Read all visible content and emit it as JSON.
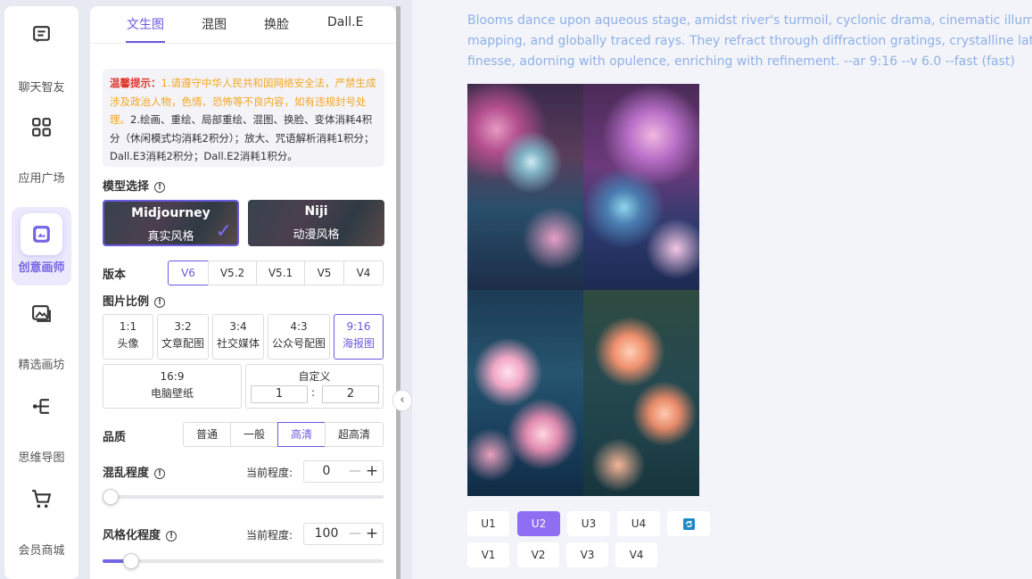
{
  "sidebar": {
    "items": [
      {
        "label": "聊天智友",
        "icon": "chat-icon"
      },
      {
        "label": "应用广场",
        "icon": "apps-grid-icon"
      },
      {
        "label": "创意画师",
        "icon": "paint-icon",
        "active": true
      },
      {
        "label": "精选画坊",
        "icon": "gallery-icon"
      },
      {
        "label": "思维导图",
        "icon": "mindmap-icon"
      },
      {
        "label": "会员商城",
        "icon": "cart-icon"
      }
    ]
  },
  "panel": {
    "tabs": [
      "文生图",
      "混图",
      "换脸",
      "Dall.E"
    ],
    "active_tab": "文生图",
    "notice": {
      "title": "温馨提示：",
      "part1": "1.请遵守中华人民共和国网络安全法，严禁生成涉及政治人物，色情、恐怖等不良内容，如有违规封号处理。",
      "part2": "2.绘画、重绘、局部重绘、混图、换脸、变体消耗4积分（休闲模式均消耗2积分）；放大、咒语解析消耗1积分；Dall.E3消耗2积分；Dall.E2消耗1积分。"
    },
    "model_title": "模型选择",
    "models": [
      {
        "name": "Midjourney",
        "desc": "真实风格",
        "selected": true
      },
      {
        "name": "Niji",
        "desc": "动漫风格",
        "selected": false
      }
    ],
    "version_title": "版本",
    "versions": [
      "V6",
      "V5.2",
      "V5.1",
      "V5",
      "V4"
    ],
    "active_version": "V6",
    "ratio_title": "图片比例",
    "ratios": [
      {
        "ratio": "1:1",
        "label": "头像"
      },
      {
        "ratio": "3:2",
        "label": "文章配图"
      },
      {
        "ratio": "3:4",
        "label": "社交媒体"
      },
      {
        "ratio": "4:3",
        "label": "公众号配图"
      },
      {
        "ratio": "9:16",
        "label": "海报图"
      },
      {
        "ratio": "16:9",
        "label": "电脑壁纸"
      }
    ],
    "active_ratio": "9:16",
    "custom": {
      "label": "自定义",
      "w": "1",
      "sep": ":",
      "h": "2"
    },
    "quality_title": "品质",
    "qualities": [
      "普通",
      "一般",
      "高清",
      "超高清"
    ],
    "active_quality": "高清",
    "chaos": {
      "title": "混乱程度",
      "current_label": "当前程度:",
      "value": "0",
      "fraction": 0
    },
    "stylize": {
      "title": "风格化程度",
      "current_label": "当前程度:",
      "value": "100",
      "fraction": 0.1
    },
    "collapse_icon": "chevron-left-icon"
  },
  "main": {
    "prompt_lines": [
      "Blooms dance upon aqueous stage, amidst river's turmoil, cyclonic drama, cinematic illuminatio",
      "mapping, and globally traced rays. They refract through diffraction gratings, crystalline lattices",
      "finesse, adorning with opulence, enriching with refinement. --ar 9:16 --v 6.0 --fast  (fast)"
    ],
    "upscale_buttons": [
      "U1",
      "U2",
      "U3",
      "U4"
    ],
    "active_upscale": "U2",
    "refresh_icon": "refresh-icon",
    "variation_buttons": [
      "V1",
      "V2",
      "V3",
      "V4"
    ],
    "colors": {
      "accent": "#6a5ae0",
      "button_active": "#8f6ef3",
      "prompt_text": "#8fb0e6"
    }
  }
}
